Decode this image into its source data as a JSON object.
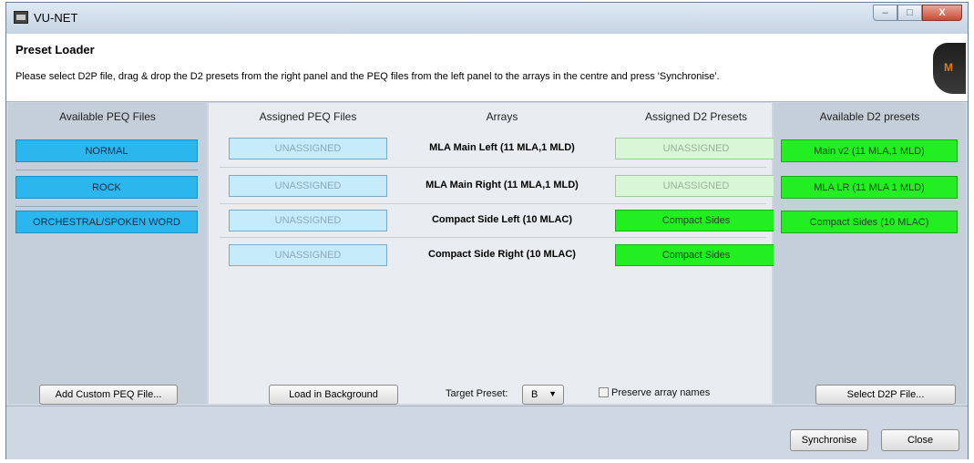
{
  "window": {
    "title": "VU-NET",
    "controls": {
      "minimize": "–",
      "maximize": "□",
      "close": "X"
    }
  },
  "header": {
    "title": "Preset Loader",
    "description": "Please select D2P file, drag & drop the D2 presets from the right panel and the PEQ files from the left panel to the arrays in the centre and press 'Synchronise'.",
    "logo_mark": "M"
  },
  "left_panel": {
    "heading": "Available PEQ Files",
    "items": [
      "NORMAL",
      "ROCK",
      "ORCHESTRAL/SPOKEN WORD"
    ],
    "add_button": "Add Custom PEQ File..."
  },
  "center_panel": {
    "headings": {
      "assigned_peq": "Assigned PEQ Files",
      "arrays": "Arrays",
      "assigned_d2": "Assigned D2 Presets"
    },
    "rows": [
      {
        "peq": "UNASSIGNED",
        "array": "MLA Main Left (11 MLA,1 MLD)",
        "d2": "UNASSIGNED"
      },
      {
        "peq": "UNASSIGNED",
        "array": "MLA Main Right (11 MLA,1 MLD)",
        "d2": "UNASSIGNED"
      },
      {
        "peq": "UNASSIGNED",
        "array": "Compact Side Left (10 MLAC)",
        "d2": "Compact Sides"
      },
      {
        "peq": "UNASSIGNED",
        "array": "Compact Side Right (10 MLAC)",
        "d2": "Compact Sides"
      }
    ],
    "load_background_button": "Load in Background",
    "target_preset_label": "Target Preset:",
    "target_preset_value": "B",
    "preserve_names_label": "Preserve array names"
  },
  "right_panel": {
    "heading": "Available D2 presets",
    "items": [
      "Main v2 (11 MLA,1 MLD)",
      "MLA LR (11 MLA 1 MLD)",
      "Compact Sides (10 MLAC)"
    ],
    "select_button": "Select D2P File..."
  },
  "footer": {
    "synchronise_button": "Synchronise",
    "close_button": "Close"
  },
  "colors": {
    "peq_blue": "#2cb6ee",
    "d2_green": "#22ee22",
    "unassigned_peq_bg": "#c6ecfb",
    "unassigned_d2_bg": "#d7f7d7"
  }
}
